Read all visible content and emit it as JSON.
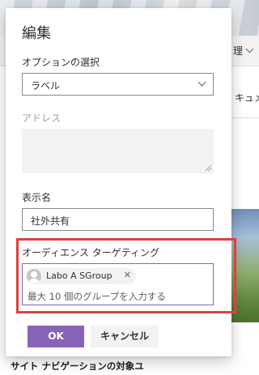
{
  "background": {
    "menu_label": "理",
    "doc_label": "キュメ",
    "bottom_title": "サイト ナビゲーションの対象ユ"
  },
  "panel": {
    "title": "編集",
    "option_label": "オプションの選択",
    "option_value": "ラベル",
    "address_label": "アドレス",
    "address_value": "",
    "display_name_label": "表示名",
    "display_name_value": "社外共有",
    "audience_label": "オーディエンス ターゲティング",
    "audience_tag": "Labo A SGroup",
    "audience_tag_remove": "✕",
    "audience_placeholder": "最大 10 個のグループを入力する",
    "ok_label": "OK",
    "cancel_label": "キャンセル"
  },
  "colors": {
    "accent": "#8764b8",
    "highlight": "#e0403c"
  }
}
